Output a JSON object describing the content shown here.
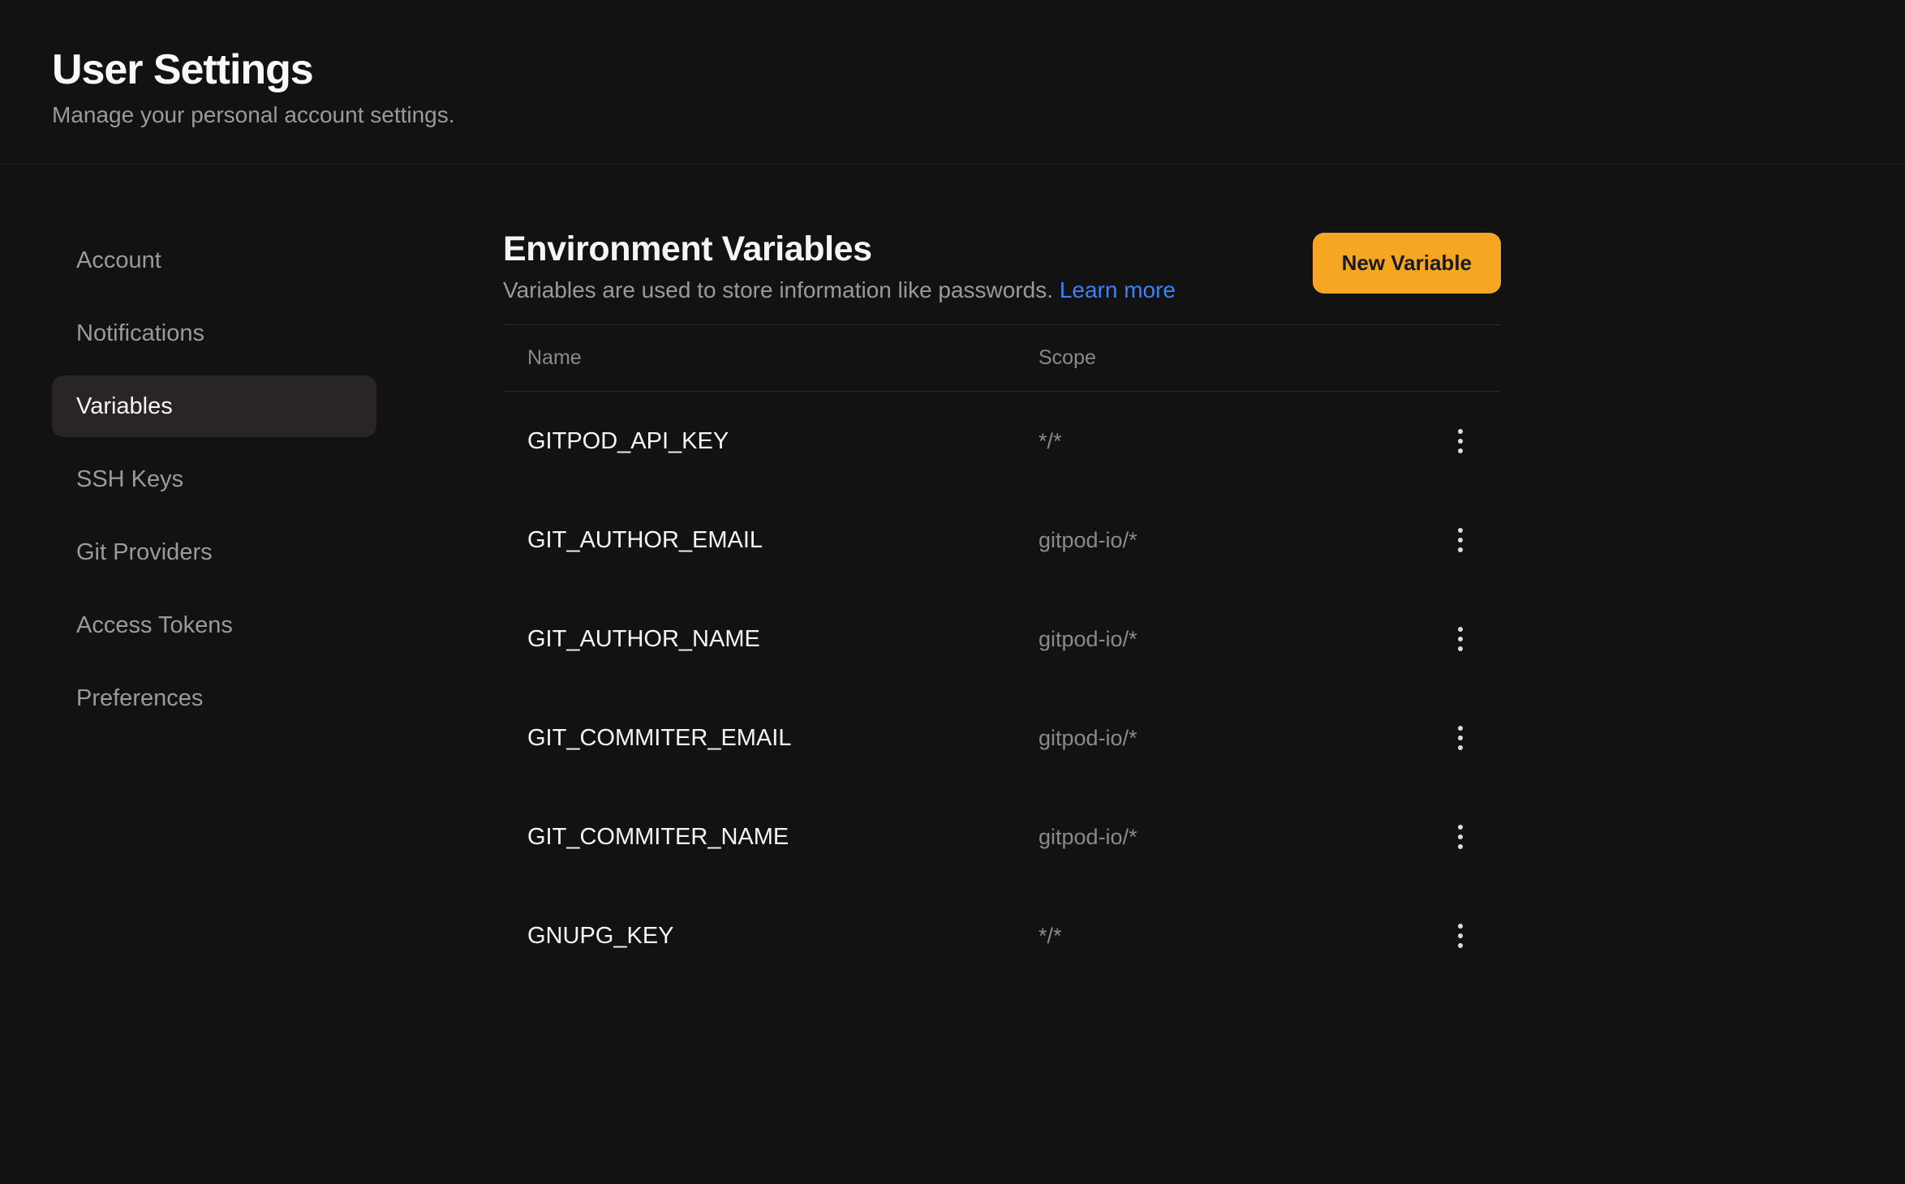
{
  "header": {
    "title": "User Settings",
    "subtitle": "Manage your personal account settings."
  },
  "sidebar": {
    "items": [
      {
        "label": "Account",
        "active": false
      },
      {
        "label": "Notifications",
        "active": false
      },
      {
        "label": "Variables",
        "active": true
      },
      {
        "label": "SSH Keys",
        "active": false
      },
      {
        "label": "Git Providers",
        "active": false
      },
      {
        "label": "Access Tokens",
        "active": false
      },
      {
        "label": "Preferences",
        "active": false
      }
    ]
  },
  "main": {
    "heading": "Environment Variables",
    "subheading": "Variables are used to store information like passwords. ",
    "learn_more_label": "Learn more",
    "new_button_label": "New Variable",
    "table": {
      "columns": {
        "name": "Name",
        "scope": "Scope"
      },
      "rows": [
        {
          "name": "GITPOD_API_KEY",
          "scope": "*/*"
        },
        {
          "name": "GIT_AUTHOR_EMAIL",
          "scope": "gitpod-io/*"
        },
        {
          "name": "GIT_AUTHOR_NAME",
          "scope": "gitpod-io/*"
        },
        {
          "name": "GIT_COMMITER_EMAIL",
          "scope": "gitpod-io/*"
        },
        {
          "name": "GIT_COMMITER_NAME",
          "scope": "gitpod-io/*"
        },
        {
          "name": "GNUPG_KEY",
          "scope": "*/*"
        }
      ]
    }
  }
}
